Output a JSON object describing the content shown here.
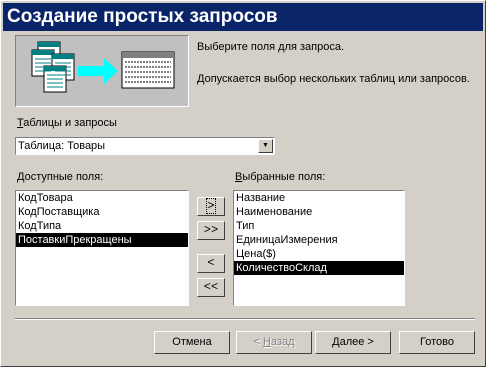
{
  "window": {
    "title": "Создание простых запросов"
  },
  "intro": {
    "line1": "Выберите поля для запроса.",
    "line2": "Допускается выбор нескольких таблиц или запросов."
  },
  "tables": {
    "label_prefix": "",
    "label_underlined": "Т",
    "label_rest": "аблицы и запросы",
    "selected": "Таблица: Товары"
  },
  "available": {
    "label_underlined": "Д",
    "label_rest": "оступные поля:",
    "items": [
      "КодТовара",
      "КодПоставщика",
      "КодТипа",
      "ПоставкиПрекращены"
    ],
    "selected_index": 3
  },
  "chosen": {
    "label_underlined": "В",
    "label_rest": "ыбранные поля:",
    "items": [
      "Название",
      "Наименование",
      "Тип",
      "ЕдиницаИзмерения",
      "Цена($)",
      "КоличествоСклад"
    ],
    "selected_index": 5
  },
  "move_buttons": {
    "add_one": ">",
    "add_all": ">>",
    "remove_one": "<",
    "remove_all": "<<"
  },
  "footer": {
    "cancel": "Отмена",
    "back_prefix": "< ",
    "back_underlined": "Н",
    "back_rest": "азад",
    "next_underlined": "Д",
    "next_rest": "алее >",
    "finish": "Готово"
  }
}
